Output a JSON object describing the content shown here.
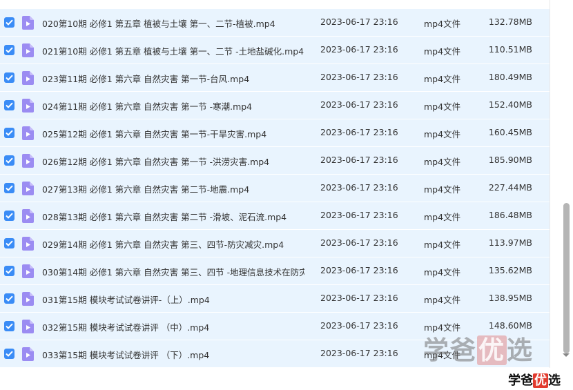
{
  "files": [
    {
      "name": "020第10期 必修1 第五章 植被与土壤 第一、二节-植被.mp4",
      "date": "2023-06-17 23:16",
      "type": "mp4文件",
      "size": "132.78MB",
      "checked": true
    },
    {
      "name": "021第10期 必修1 第五章 植被与土壤 第一、二节 -土地盐碱化.mp4",
      "date": "2023-06-17 23:16",
      "type": "mp4文件",
      "size": "110.51MB",
      "checked": true
    },
    {
      "name": "023第11期 必修1 第六章 自然灾害 第一节-台风.mp4",
      "date": "2023-06-17 23:16",
      "type": "mp4文件",
      "size": "180.49MB",
      "checked": true
    },
    {
      "name": "024第11期 必修1 第六章 自然灾害 第一节 -寒潮.mp4",
      "date": "2023-06-17 23:16",
      "type": "mp4文件",
      "size": "152.40MB",
      "checked": true
    },
    {
      "name": "025第12期 必修1 第六章 自然灾害 第一节-干旱灾害.mp4",
      "date": "2023-06-17 23:16",
      "type": "mp4文件",
      "size": "160.45MB",
      "checked": true
    },
    {
      "name": "026第12期 必修1 第六章 自然灾害 第一节 -洪涝灾害.mp4",
      "date": "2023-06-17 23:16",
      "type": "mp4文件",
      "size": "185.90MB",
      "checked": true
    },
    {
      "name": "027第13期 必修1 第六章 自然灾害 第二节-地震.mp4",
      "date": "2023-06-17 23:16",
      "type": "mp4文件",
      "size": "227.44MB",
      "checked": true
    },
    {
      "name": "028第13期 必修1 第六章 自然灾害 第二节 -滑坡、泥石流.mp4",
      "date": "2023-06-17 23:16",
      "type": "mp4文件",
      "size": "186.48MB",
      "checked": true
    },
    {
      "name": "029第14期 必修1 第六章 自然灾害 第三、四节-防灾减灾.mp4",
      "date": "2023-06-17 23:16",
      "type": "mp4文件",
      "size": "113.97MB",
      "checked": true
    },
    {
      "name": "030第14期 必修1 第六章 自然灾害 第三、四节 -地理信息技术在防灾...",
      "date": "2023-06-17 23:16",
      "type": "mp4文件",
      "size": "135.62MB",
      "checked": true
    },
    {
      "name": "031第15期 模块考试试卷讲评-（上）.mp4",
      "date": "2023-06-17 23:16",
      "type": "mp4文件",
      "size": "138.95MB",
      "checked": true
    },
    {
      "name": "032第15期 模块考试试卷讲评 （中）.mp4",
      "date": "2023-06-17 23:16",
      "type": "mp4文件",
      "size": "148.60MB",
      "checked": true
    },
    {
      "name": "033第15期 模块考试试卷讲评 （下）.mp4",
      "date": "2023-06-17 23:16",
      "type": "mp4文件",
      "size": "",
      "checked": true
    }
  ],
  "watermark": {
    "pre": "学爸",
    "hl": "优",
    "post": "选"
  },
  "colors": {
    "row_bg": "#e9f4fe",
    "checkbox": "#3a8cf6",
    "file_icon": "#9b8cf2"
  }
}
